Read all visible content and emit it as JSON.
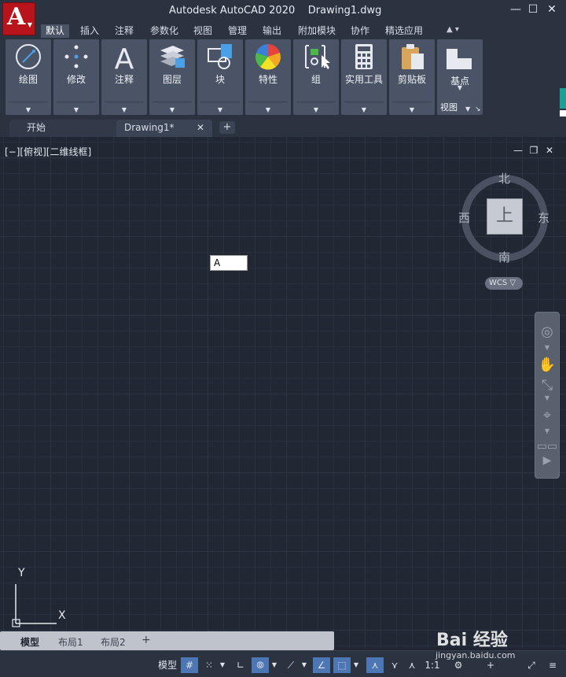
{
  "app": {
    "title": "Autodesk AutoCAD 2020",
    "document": "Drawing1.dwg",
    "logo_letter": "A",
    "controls": {
      "minimize": "—",
      "maximize": "☐",
      "close": "✕"
    }
  },
  "ribbon_tabs": [
    "默认",
    "插入",
    "注释",
    "参数化",
    "视图",
    "管理",
    "输出",
    "附加模块",
    "协作",
    "精选应用"
  ],
  "ribbon_panels": [
    {
      "label": "绘图",
      "icon": "draw-circle-icon"
    },
    {
      "label": "修改",
      "icon": "modify-move-icon"
    },
    {
      "label": "注释",
      "icon": "annotation-text-icon"
    },
    {
      "label": "图层",
      "icon": "layers-icon"
    },
    {
      "label": "块",
      "icon": "block-insert-icon"
    },
    {
      "label": "特性",
      "icon": "properties-color-wheel-icon"
    },
    {
      "label": "组",
      "icon": "group-icon"
    },
    {
      "label": "实用工具",
      "icon": "calculator-icon"
    },
    {
      "label": "剪贴板",
      "icon": "clipboard-icon"
    }
  ],
  "ribbon_base": {
    "label": "基点",
    "view_label": "视图"
  },
  "file_tabs": {
    "start": "开始",
    "drawing": "Drawing1*",
    "close": "✕",
    "add": "+"
  },
  "viewport": {
    "label": "[−][俯视][二维线框]",
    "controls": {
      "minimize": "—",
      "restore": "❐",
      "close": "✕"
    },
    "text_input_value": "A"
  },
  "viewcube": {
    "north": "北",
    "south": "南",
    "east": "东",
    "west": "西",
    "face": "上",
    "wcs": "WCS ▽"
  },
  "ucs": {
    "x": "X",
    "y": "Y"
  },
  "layout_tabs": {
    "model": "模型",
    "layout1": "布局1",
    "layout2": "布局2",
    "add": "+"
  },
  "statusbar": {
    "model": "模型",
    "scale": "1:1"
  },
  "watermark": {
    "brand": "Bai 经验",
    "url": "jingyan.baidu.com"
  },
  "colors": {
    "background": "#212834",
    "chrome": "#2b3240",
    "panel": "#4a5466",
    "accent": "#4c76b4",
    "logo": "#b8141b"
  }
}
